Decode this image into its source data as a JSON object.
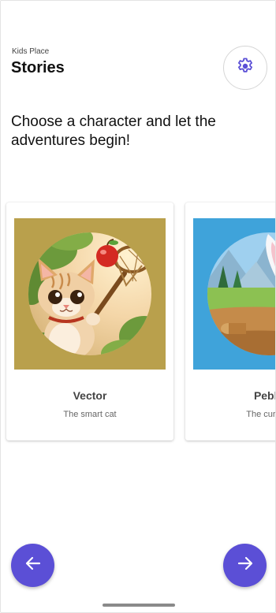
{
  "header": {
    "app_label": "Kids Place",
    "title": "Stories",
    "settings_icon": "gear-icon"
  },
  "intro_text": "Choose a character and let the adventures begin!",
  "characters": [
    {
      "name": "Vector",
      "tagline": "The smart cat",
      "image": "cat-with-apple-net-illustration",
      "bg_color": "#b9a04c"
    },
    {
      "name": "Pebbl",
      "tagline": "The curious",
      "image": "bunny-illustration",
      "bg_color": "#3fa3da"
    }
  ],
  "navigation": {
    "prev_icon": "arrow-left-icon",
    "next_icon": "arrow-right-icon"
  },
  "colors": {
    "accent": "#5b4fd6",
    "settings_icon": "#5b4fd6"
  }
}
